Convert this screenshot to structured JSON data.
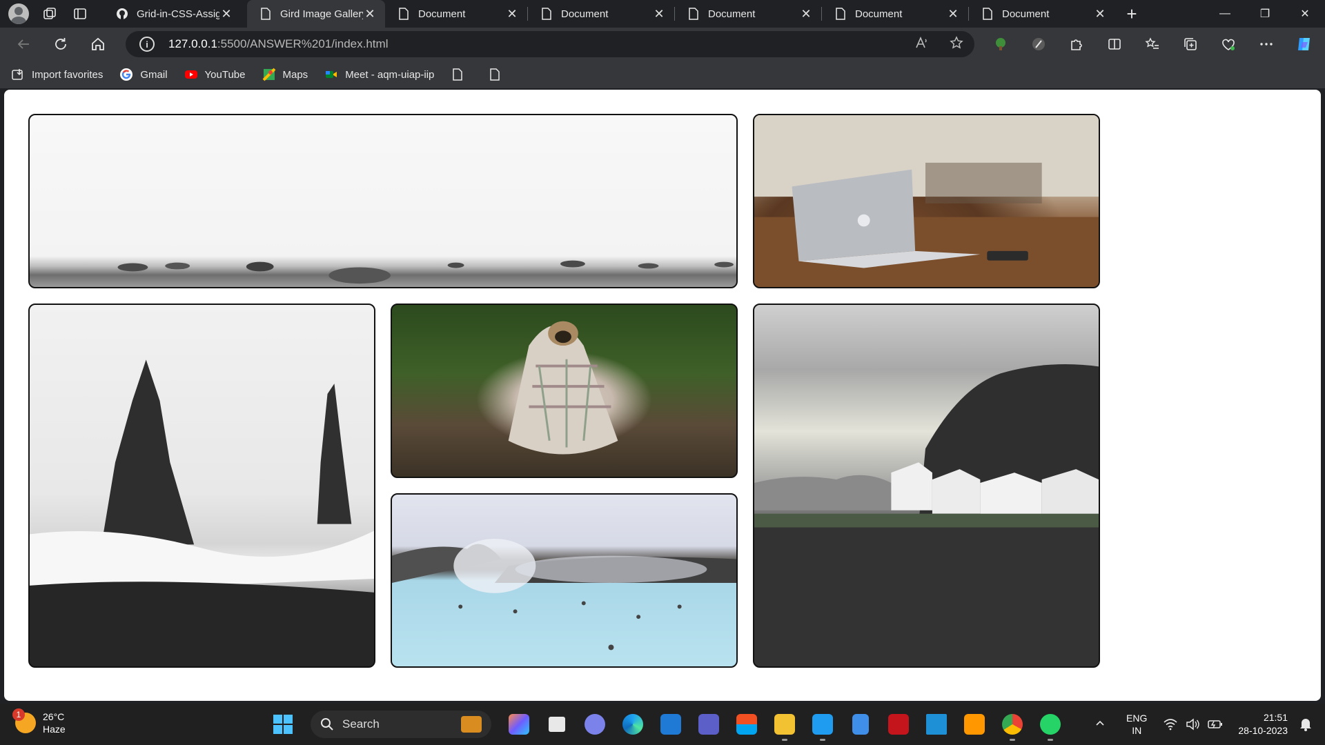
{
  "browser": {
    "tabs": [
      {
        "title": "Grid-in-CSS-Assignm",
        "favicon": "github-icon",
        "active": false
      },
      {
        "title": "Gird Image Gallery",
        "favicon": "page-icon",
        "active": true
      },
      {
        "title": "Document",
        "favicon": "page-icon",
        "active": false
      },
      {
        "title": "Document",
        "favicon": "page-icon",
        "active": false
      },
      {
        "title": "Document",
        "favicon": "page-icon",
        "active": false
      },
      {
        "title": "Document",
        "favicon": "page-icon",
        "active": false
      },
      {
        "title": "Document",
        "favicon": "page-icon",
        "active": false
      }
    ],
    "new_tab_label": "+",
    "tab_close_glyph": "✕",
    "window_controls": {
      "minimize": "—",
      "restore": "❐",
      "close": "✕"
    },
    "address": {
      "host": "127.0.0.1",
      "path": ":5500/ANSWER%201/index.html"
    },
    "favorites": [
      {
        "label": "Import favorites",
        "icon": "import-icon"
      },
      {
        "label": "Gmail",
        "icon": "google-icon"
      },
      {
        "label": "YouTube",
        "icon": "youtube-icon"
      },
      {
        "label": "Maps",
        "icon": "maps-icon"
      },
      {
        "label": "Meet - aqm-uiap-iip",
        "icon": "meet-icon"
      },
      {
        "label": "",
        "icon": "page-icon"
      },
      {
        "label": "",
        "icon": "page-icon"
      }
    ]
  },
  "gallery": {
    "images": [
      {
        "name": "rocky-shore-image"
      },
      {
        "name": "laptop-desk-image"
      },
      {
        "name": "sea-stacks-image"
      },
      {
        "name": "pug-blanket-image"
      },
      {
        "name": "blue-lagoon-image"
      },
      {
        "name": "cliff-village-image"
      }
    ]
  },
  "taskbar": {
    "weather": {
      "temp": "26°C",
      "condition": "Haze",
      "badge": "1"
    },
    "search_placeholder": "Search",
    "language": {
      "line1": "ENG",
      "line2": "IN"
    },
    "clock": {
      "time": "21:51",
      "date": "28-10-2023"
    },
    "accent": "#4cc2ff"
  }
}
